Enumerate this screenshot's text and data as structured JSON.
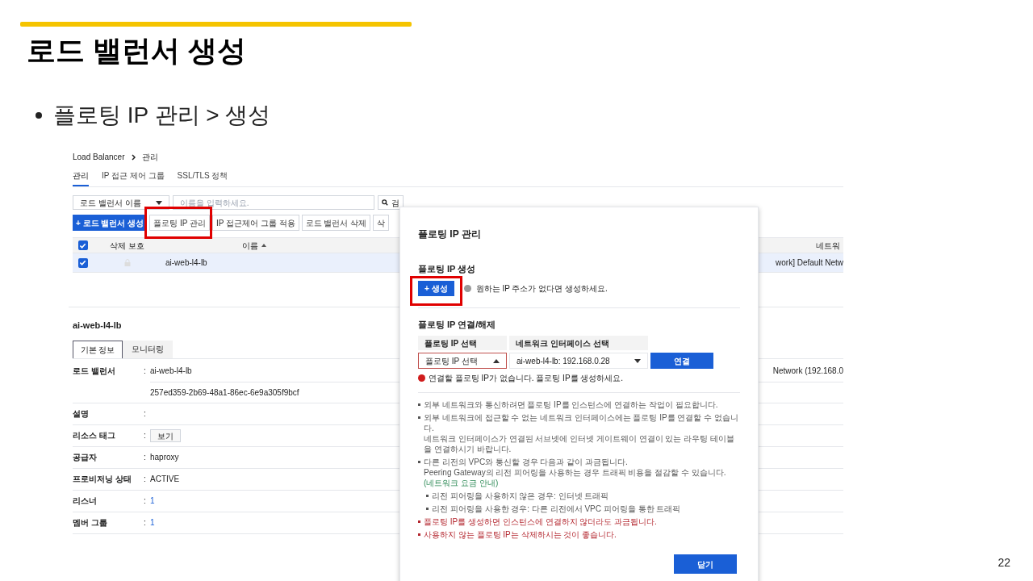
{
  "slide": {
    "title": "로드 밸런서 생성",
    "bullet": "플로팅 IP 관리 > 생성",
    "page_number": "22"
  },
  "breadcrumb": [
    "Load Balancer",
    "관리"
  ],
  "tabs": [
    {
      "label": "관리",
      "selected": true
    },
    {
      "label": "IP 접근 제어 그룹",
      "selected": false
    },
    {
      "label": "SSL/TLS 정책",
      "selected": false
    }
  ],
  "filter": {
    "select": "로드 밸런서 이름",
    "placeholder": "이름을 입력하세요.",
    "search_button": "검"
  },
  "toolbar": [
    {
      "label": "+ 로드 밸런서 생성",
      "kind": "primary",
      "highlighted": false
    },
    {
      "label": "플로팅 IP 관리",
      "kind": "default",
      "highlighted": true
    },
    {
      "label": "IP 접근제어 그룹 적용",
      "kind": "default",
      "highlighted": false
    },
    {
      "label": "로드 밸런서 삭제",
      "kind": "default",
      "highlighted": false
    },
    {
      "label": "삭",
      "kind": "default",
      "highlighted": false
    }
  ],
  "table": {
    "header_checked": true,
    "columns": [
      "삭제 보호",
      "이름",
      "네트워"
    ],
    "rows": [
      {
        "checked": true,
        "selected": true,
        "name": "ai-web-l4-lb",
        "network": "work] Default Netw"
      }
    ]
  },
  "detail": {
    "title": "ai-web-l4-lb",
    "tabs": [
      {
        "label": "기본 정보",
        "selected": true
      },
      {
        "label": "모니터링",
        "selected": false
      }
    ],
    "side_text": "Network (192.168.0",
    "fields": [
      {
        "label": "로드 밸런서",
        "colon": ":",
        "kind": "text",
        "values": [
          "ai-web-l4-lb",
          "257ed359-2b69-48a1-86ec-6e9a305f9bcf"
        ]
      },
      {
        "label": "설명",
        "colon": ":"
      },
      {
        "label": "리소스 태그",
        "colon": ":",
        "kind": "button",
        "values": [
          "보기"
        ]
      },
      {
        "label": "공급자",
        "colon": ":",
        "kind": "text",
        "values": [
          "haproxy"
        ]
      },
      {
        "label": "프로비저닝 상태",
        "colon": ":",
        "kind": "text",
        "values": [
          "ACTIVE"
        ]
      },
      {
        "label": "리스너",
        "colon": ":",
        "kind": "link",
        "values": [
          "1"
        ]
      },
      {
        "label": "멤버 그룹",
        "colon": ":",
        "kind": "link",
        "values": [
          "1"
        ]
      }
    ]
  },
  "modal": {
    "title": "플로팅 IP 관리",
    "create": {
      "heading": "플로팅 IP 생성",
      "button": "+ 생성",
      "highlighted": true,
      "info": "원하는 IP 주소가 없다면 생성하세요."
    },
    "connect": {
      "heading": "플로팅 IP 연결/해제",
      "columns": [
        "플로팅 IP 선택",
        "네트워크 인터페이스 선택"
      ],
      "ip_select": {
        "value": "플로팅 IP 선택",
        "invalid": true,
        "expanded": true
      },
      "nic_select": {
        "value": "ai-web-l4-lb: 192.168.0.28",
        "invalid": false,
        "expanded": false
      },
      "button": "연결",
      "error": "연결할 플로팅 IP가 없습니다. 플로팅 IP를 생성하세요."
    },
    "notes": [
      {
        "kind": "info",
        "lines": [
          "외부 네트워크와 통신하려면 플로팅 IP를 인스턴스에 연결하는 작업이 필요합니다."
        ]
      },
      {
        "kind": "info",
        "lines": [
          "외부 네트워크에 접근할 수 없는 네트워크 인터페이스에는 플로팅 IP를 연결할 수 없습니다.",
          "네트워크 인터페이스가 연결된 서브넷에 인터넷 게이트웨이 연결이 있는 라우팅 테이블을 연결하시기 바랍니다."
        ]
      },
      {
        "kind": "info",
        "lines": [
          "다른 리전의 VPC와 통신할 경우 다음과 같이 과금됩니다.",
          "Peering Gateway의 리전 피어링을 사용하는 경우 트래픽 비용을 절감할 수 있습니다."
        ],
        "link": "(네트워크 요금 안내)"
      },
      {
        "kind": "sub",
        "lines": [
          "리전 피어링을 사용하지 않은 경우: 인터넷 트래픽"
        ]
      },
      {
        "kind": "sub",
        "lines": [
          "리전 피어링을 사용한 경우: 다른 리전에서 VPC 피어링을 통한 트래픽"
        ]
      },
      {
        "kind": "warning",
        "lines": [
          "플로팅 IP를 생성하면 인스턴스에 연결하지 않더라도 과금됩니다."
        ]
      },
      {
        "kind": "warning",
        "lines": [
          "사용하지 않는 플로팅 IP는 삭제하시는 것이 좋습니다."
        ]
      }
    ],
    "close_button": "닫기"
  }
}
